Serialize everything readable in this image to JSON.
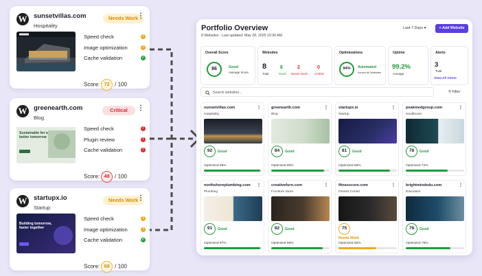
{
  "site_cards": [
    {
      "domain": "sunsetvillas.com",
      "category": "Hospitality",
      "badge": "Needs Work",
      "checks": [
        "Speed check",
        "Image optimization",
        "Cache validation"
      ],
      "check_status": [
        "warning",
        "warning",
        "ok"
      ],
      "score_label": "Score:",
      "score": "72",
      "score_max": "/ 100"
    },
    {
      "domain": "greenearth.com",
      "category": "Blog",
      "badge": "Critical",
      "checks": [
        "Speed check",
        "Plugin review",
        "Cache validation"
      ],
      "check_status": [
        "error",
        "error",
        "error"
      ],
      "score_label": "Score:",
      "score": "48",
      "score_max": "/ 100",
      "thumb_headline": "Sustainable for a better tomorrow"
    },
    {
      "domain": "startupx.io",
      "category": "Startup",
      "badge": "Needs Work",
      "checks": [
        "Speed check",
        "Image optimization",
        "Cache validation"
      ],
      "check_status": [
        "warning",
        "warning",
        "ok"
      ],
      "score_label": "Score:",
      "score": "68",
      "score_max": "/ 100",
      "thumb_headline": "Building tomorrow, faster together"
    }
  ],
  "dashboard": {
    "title": "Portfolio Overview",
    "subtitle": "8 Websites - Last updated: May 28, 2025 10:30 AM",
    "range": "Last 7 Days",
    "add_button": "+ Add Website",
    "stats": {
      "overall": {
        "title": "Overall Score",
        "value": "86",
        "label": "Good",
        "caption": "Average Score"
      },
      "websites": {
        "title": "Websites",
        "total": "8",
        "total_label": "Total",
        "good": "6",
        "good_label": "Good",
        "needs": "2",
        "needs_label": "Needs Work",
        "critical": "0",
        "critical_label": "Critical"
      },
      "optimizations": {
        "title": "Optimizations",
        "value": "94%",
        "label": "Automated",
        "caption": "Across All Websites"
      },
      "uptime": {
        "title": "Uptime",
        "value": "99.2%",
        "caption": "Average"
      },
      "alerts": {
        "title": "Alerts",
        "value": "3",
        "caption": "Total",
        "link": "View All Alerts"
      }
    },
    "search_placeholder": "Search websites...",
    "filter": "Filter",
    "websites": [
      {
        "domain": "sunsetvillas.com",
        "category": "Hospitality",
        "score": "92",
        "status": "Good",
        "optimized": "Optimized 96%",
        "pct": 96
      },
      {
        "domain": "greenearth.com",
        "category": "Blog",
        "score": "84",
        "status": "Good",
        "optimized": "Optimized 90%",
        "pct": 90
      },
      {
        "domain": "startupx.io",
        "category": "Startup",
        "score": "81",
        "status": "Good",
        "optimized": "Optimized 88%",
        "pct": 88
      },
      {
        "domain": "peakmedgroup.com",
        "category": "Healthcare",
        "score": "78",
        "status": "Good",
        "optimized": "Optimized 72%",
        "pct": 72
      },
      {
        "domain": "northshoreplumbing.com",
        "category": "Plumbing",
        "score": "91",
        "status": "Good",
        "optimized": "Optimized 97%",
        "pct": 97
      },
      {
        "domain": "creativefurn.com",
        "category": "Furniture Store",
        "score": "82",
        "status": "Good",
        "optimized": "Optimized 88%",
        "pct": 88
      },
      {
        "domain": "fitnesscore.com",
        "category": "Fitness Center",
        "score": "75",
        "status": "Needs Work",
        "optimized": "Optimized 65%",
        "pct": 65
      },
      {
        "domain": "brightmindedu.com",
        "category": "Education",
        "score": "78",
        "status": "Good",
        "optimized": "Optimized 76%",
        "pct": 76
      }
    ]
  },
  "colors": {
    "accent": "#5b3fe0",
    "good": "#1e9a3a",
    "warning": "#f2a81d",
    "critical": "#d6262f",
    "background": "#e9e6f8"
  }
}
